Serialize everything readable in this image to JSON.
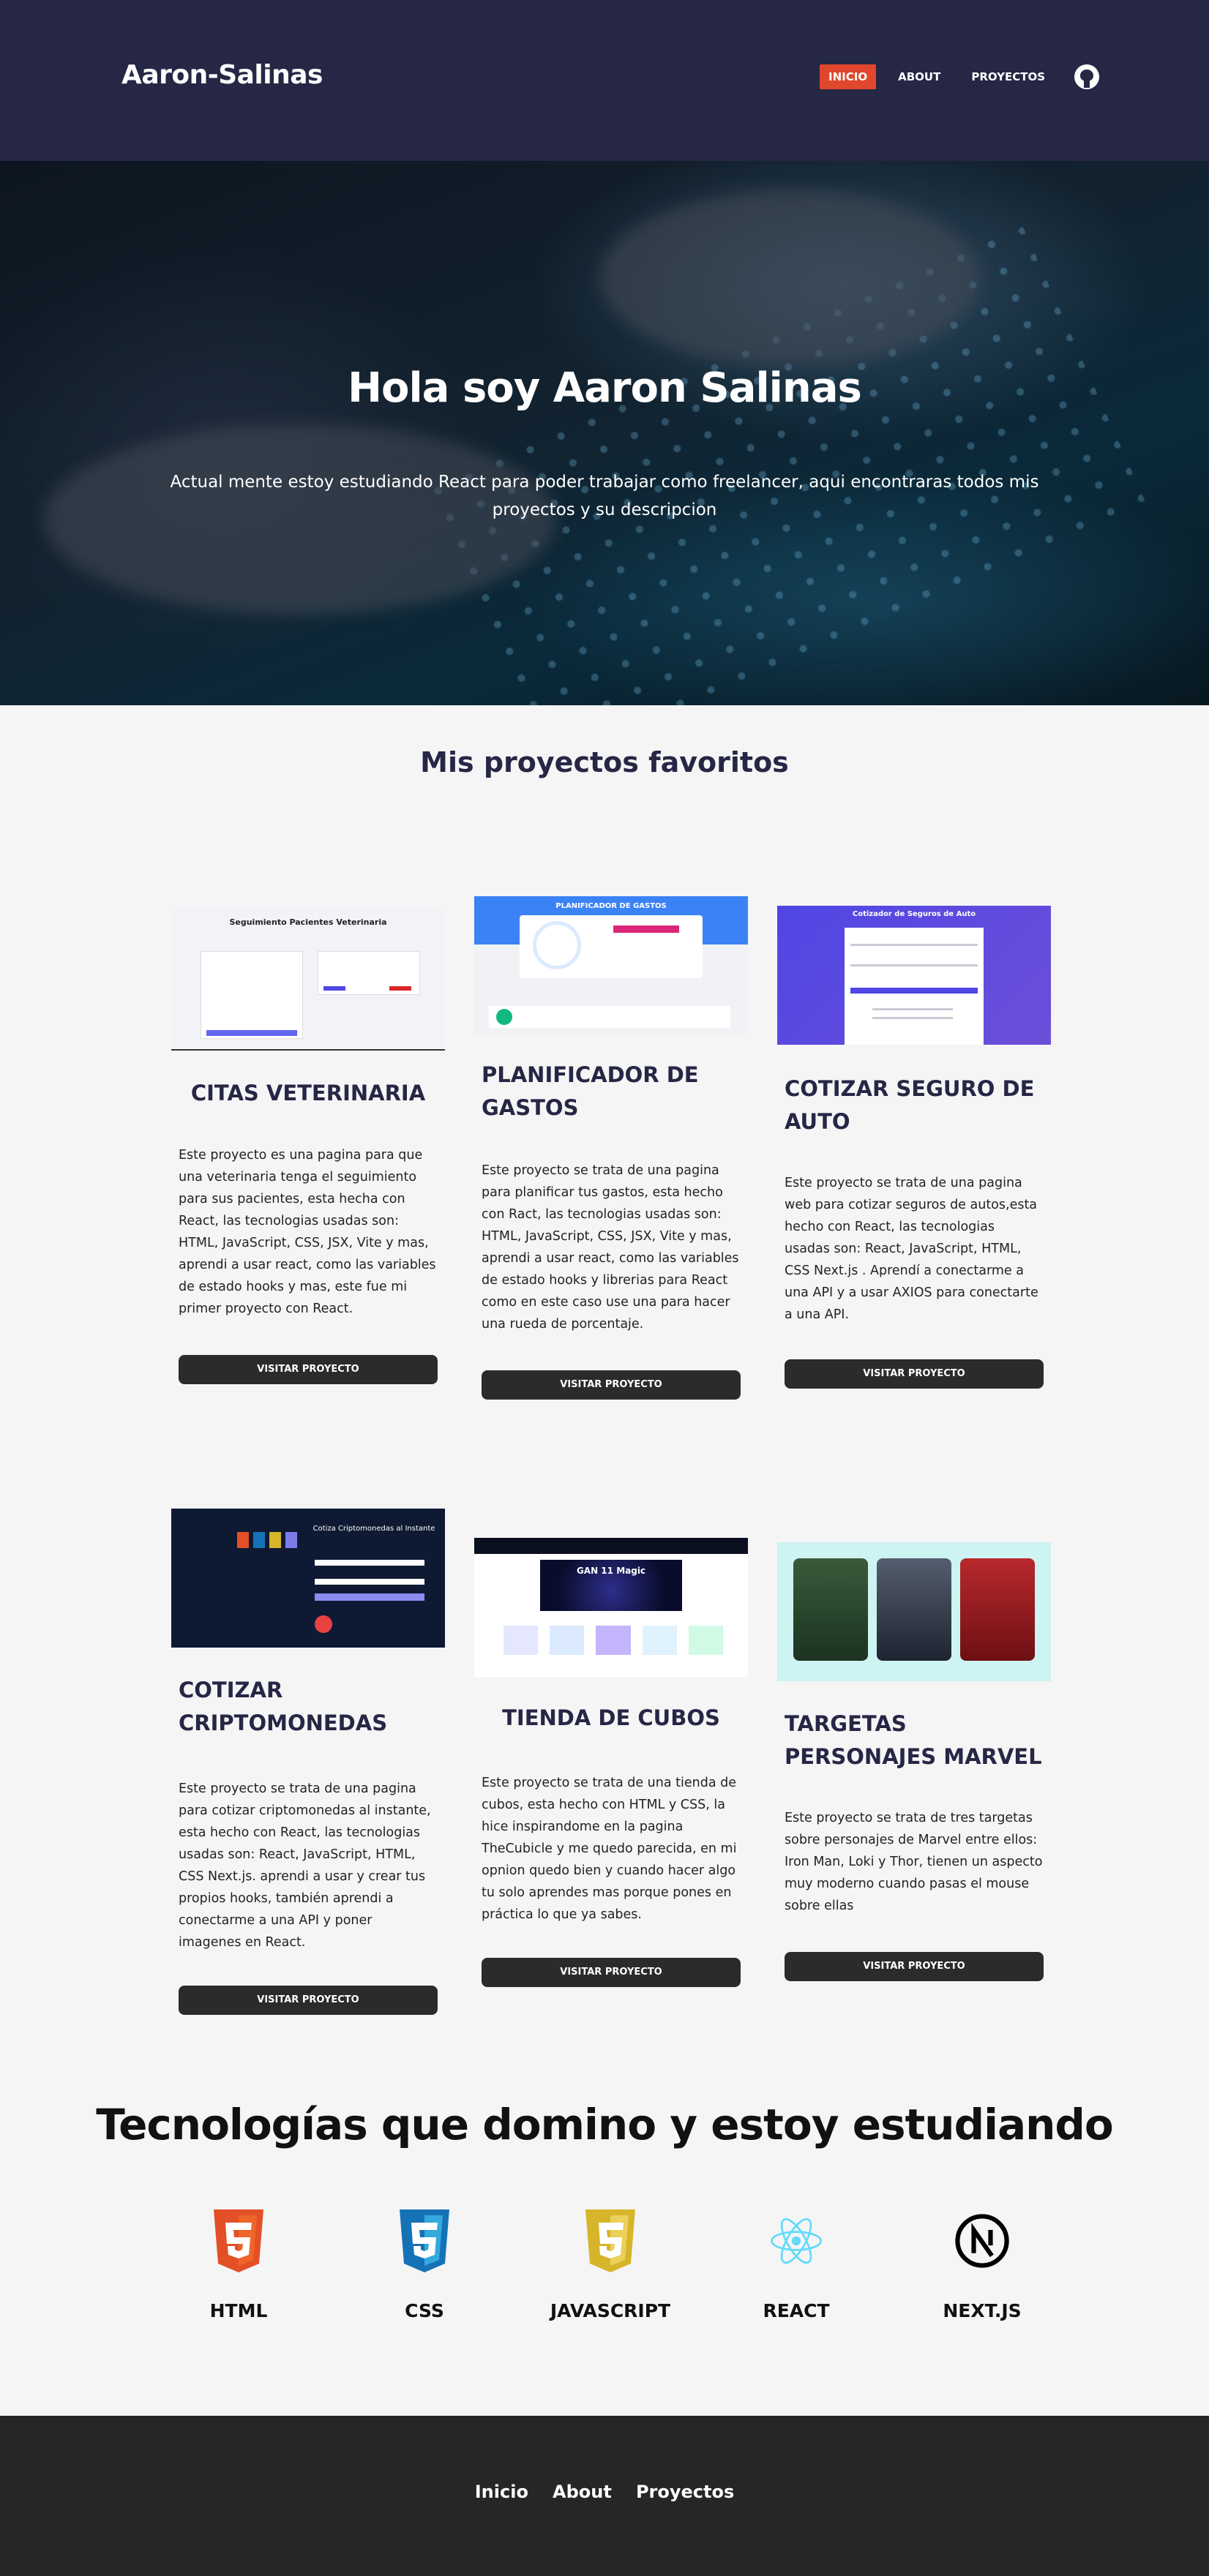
{
  "header": {
    "brand": "Aaron-Salinas",
    "nav": [
      {
        "label": "INICIO",
        "active": true
      },
      {
        "label": "ABOUT",
        "active": false
      },
      {
        "label": "PROYECTOS",
        "active": false
      }
    ],
    "github_icon": "github-icon"
  },
  "hero": {
    "title": "Hola soy Aaron Salinas",
    "subtitle": "Actual mente estoy estudiando React para poder trabajar como freelancer, aqui encontraras todos mis proyectos y su descripcion"
  },
  "projects": {
    "title": "Mis proyectos favoritos",
    "button_label": "VISITAR PROYECTO",
    "items": [
      {
        "title": "CITAS VETERINARIA",
        "description": "Este proyecto es una pagina para que una veterinaria tenga el seguimiento para sus pacientes, esta hecha con React, las tecnologias usadas son: HTML, JavaScript, CSS, JSX, Vite y mas, aprendi a usar react, como las variables de estado hooks y mas, este fue mi primer proyecto con React.",
        "thumb_title": "Seguimiento Pacientes Veterinaria"
      },
      {
        "title": "PLANIFICADOR DE GASTOS",
        "description": "Este proyecto se trata de una pagina para planificar tus gastos, esta hecho con Ract, las tecnologias usadas son: HTML, JavaScript, CSS, JSX, Vite y mas, aprendi a usar react, como las variables de estado hooks y librerias para React como en este caso use una para hacer una rueda de porcentaje.",
        "thumb_title": "PLANIFICADOR DE GASTOS"
      },
      {
        "title": "COTIZAR SEGURO DE AUTO",
        "description": "Este proyecto se trata de una pagina web para cotizar seguros de autos,esta hecho con React, las tecnologias usadas son: React, JavaScript, HTML, CSS Next.js . Aprendí a conectarme a una API y a usar AXIOS para conectarte a una API.",
        "thumb_title": "Cotizador de Seguros de Auto"
      },
      {
        "title": "COTIZAR CRIPTOMONEDAS",
        "description": "Este proyecto se trata de una pagina para cotizar criptomonedas al instante, esta hecho con React, las tecnologias usadas son: React, JavaScript, HTML, CSS Next.js. aprendi a usar y crear tus propios hooks, también aprendi a conectarme a una API y poner imagenes en React.",
        "thumb_title": "Cotiza Criptomonedas al Instante"
      },
      {
        "title": "TIENDA DE CUBOS",
        "description": "Este proyecto se trata de una tienda de cubos, esta hecho con HTML y CSS, la hice inspirandome en la pagina TheCubicle y me quedo parecida, en mi opnion quedo bien y cuando hacer algo tu solo aprendes mas porque pones en práctica lo que ya sabes.",
        "thumb_title": "GAN 11 Magic"
      },
      {
        "title": "TARGETAS PERSONAJES MARVEL",
        "description": "Este proyecto se trata de tres targetas sobre personajes de Marvel entre ellos: Iron Man, Loki y Thor, tienen un aspecto muy moderno cuando pasas el mouse sobre ellas",
        "thumb_title": ""
      }
    ]
  },
  "tech": {
    "title": "Tecnologías que domino y estoy estudiando",
    "items": [
      {
        "label": "HTML",
        "icon": "html5-icon",
        "color": "#e34f26"
      },
      {
        "label": "CSS",
        "icon": "css3-icon",
        "color": "#1572b6"
      },
      {
        "label": "JAVASCRIPT",
        "icon": "javascript-icon",
        "color": "#d6b52a"
      },
      {
        "label": "REACT",
        "icon": "react-icon",
        "color": "#61dafb"
      },
      {
        "label": "NEXT.JS",
        "icon": "nextjs-icon",
        "color": "#000000"
      }
    ]
  },
  "footer": {
    "nav": [
      "Inicio",
      "About",
      "Proyectos"
    ]
  },
  "colors": {
    "header_bg": "#262645",
    "accent": "#e0472c",
    "button_bg": "#2b2b2b",
    "footer_bg": "#262626"
  }
}
